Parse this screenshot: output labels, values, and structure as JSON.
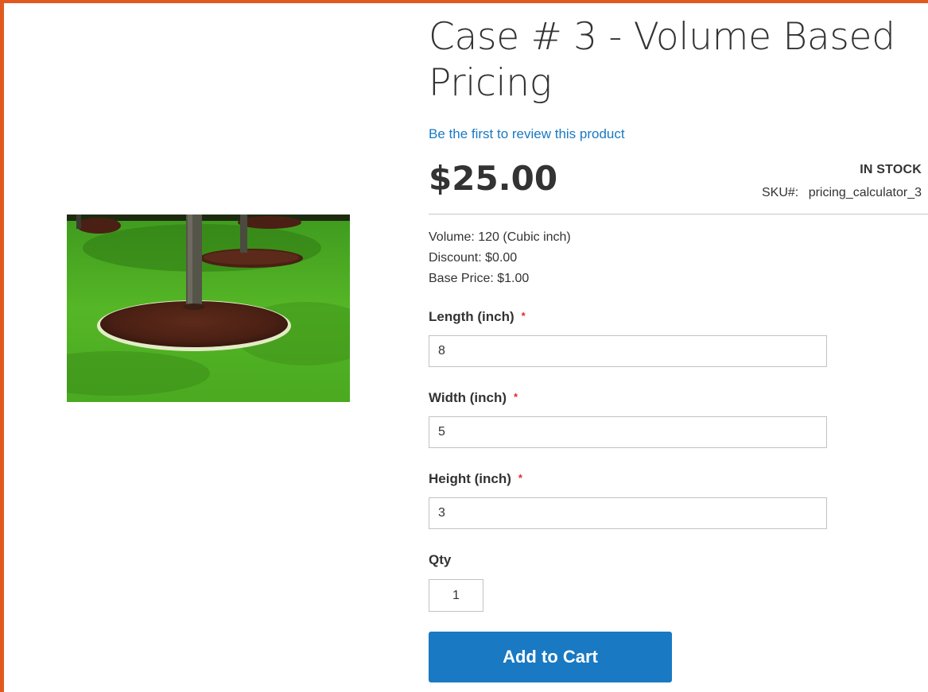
{
  "product": {
    "title": "Case # 3 - Volume Based Pricing",
    "review_link": "Be the first to review this product",
    "price": "$25.00",
    "stock_status": "IN STOCK",
    "sku_label": "SKU#:",
    "sku_value": "pricing_calculator_3",
    "image_icon": "product-photo-lawn-trees-mulch"
  },
  "summary": {
    "volume": "Volume: 120 (Cubic inch)",
    "discount": "Discount: $0.00",
    "base_price": "Base Price: $1.00"
  },
  "fields": {
    "length": {
      "label": "Length (inch)",
      "required_mark": "*",
      "value": "8"
    },
    "width": {
      "label": "Width (inch)",
      "required_mark": "*",
      "value": "5"
    },
    "height": {
      "label": "Height (inch)",
      "required_mark": "*",
      "value": "3"
    },
    "qty": {
      "label": "Qty",
      "value": "1"
    }
  },
  "actions": {
    "add_to_cart": "Add to Cart"
  },
  "colors": {
    "accent_border": "#e05a1f",
    "link": "#1979c3",
    "button": "#1979c3",
    "required": "#e02b27"
  }
}
